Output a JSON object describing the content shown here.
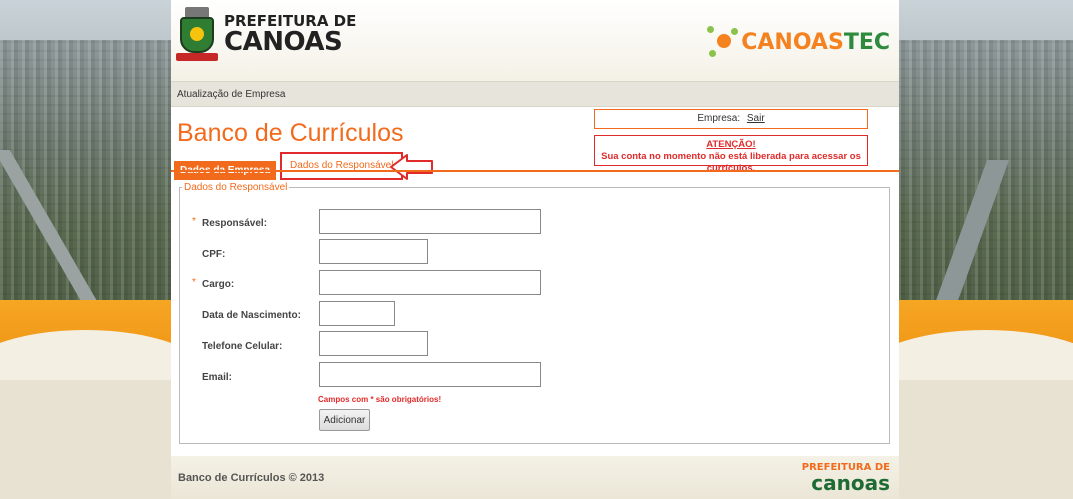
{
  "header": {
    "logo_line1": "PREFEITURA DE",
    "logo_line2": "CANOAS",
    "brand_part1": "CANOAS",
    "brand_part2": "TEC"
  },
  "breadcrumb": "Atualização de Empresa",
  "page_title": "Banco de Currículos",
  "tabs": [
    {
      "label": "Dados da Empresa",
      "active": true
    },
    {
      "label": "Dados do Responsável",
      "active": false
    }
  ],
  "company": {
    "label": "Empresa:",
    "logout_label": "Sair"
  },
  "warning": {
    "title": "ATENÇÃO!",
    "message": "Sua conta no momento não está liberada para acessar os currículos."
  },
  "form": {
    "legend": "Dados do Responsável",
    "required_marker": "*",
    "fields": [
      {
        "label": "Responsável:",
        "value": "",
        "required": true
      },
      {
        "label": "CPF:",
        "value": "",
        "required": false
      },
      {
        "label": "Cargo:",
        "value": "",
        "required": true
      },
      {
        "label": "Data de Nascimento:",
        "value": "",
        "required": false
      },
      {
        "label": "Telefone Celular:",
        "value": "",
        "required": false
      },
      {
        "label": "Email:",
        "value": "",
        "required": false
      }
    ],
    "required_hint": "Campos com * são obrigatórios!",
    "submit_label": "Adicionar"
  },
  "footer": {
    "copyright": "Banco de Currículos © 2013",
    "logo_line1": "PREFEITURA DE",
    "logo_line2": "canoas"
  },
  "colors": {
    "accent": "#f26b1d",
    "alert": "#e12a2a",
    "brand_green": "#2e8b3d"
  }
}
